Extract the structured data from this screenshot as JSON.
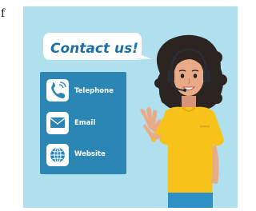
{
  "edge_text": "f",
  "speech_bubble": {
    "text": "Contact us!"
  },
  "contact_panel": {
    "items": [
      {
        "label": "Telephone",
        "icon": "telephone-icon"
      },
      {
        "label": "Email",
        "icon": "email-icon"
      },
      {
        "label": "Website",
        "icon": "globe-icon"
      }
    ]
  },
  "colors": {
    "background_panel": "#a8dbeb",
    "bubble_fill": "#ffffff",
    "bubble_text": "#1e6fa3",
    "contact_panel": "#2b86b3",
    "shirt": "#f7c21a",
    "skin": "#e9ab87",
    "hair": "#2b2420",
    "headset": "#2c2d33",
    "pants": "#2f90c5"
  }
}
